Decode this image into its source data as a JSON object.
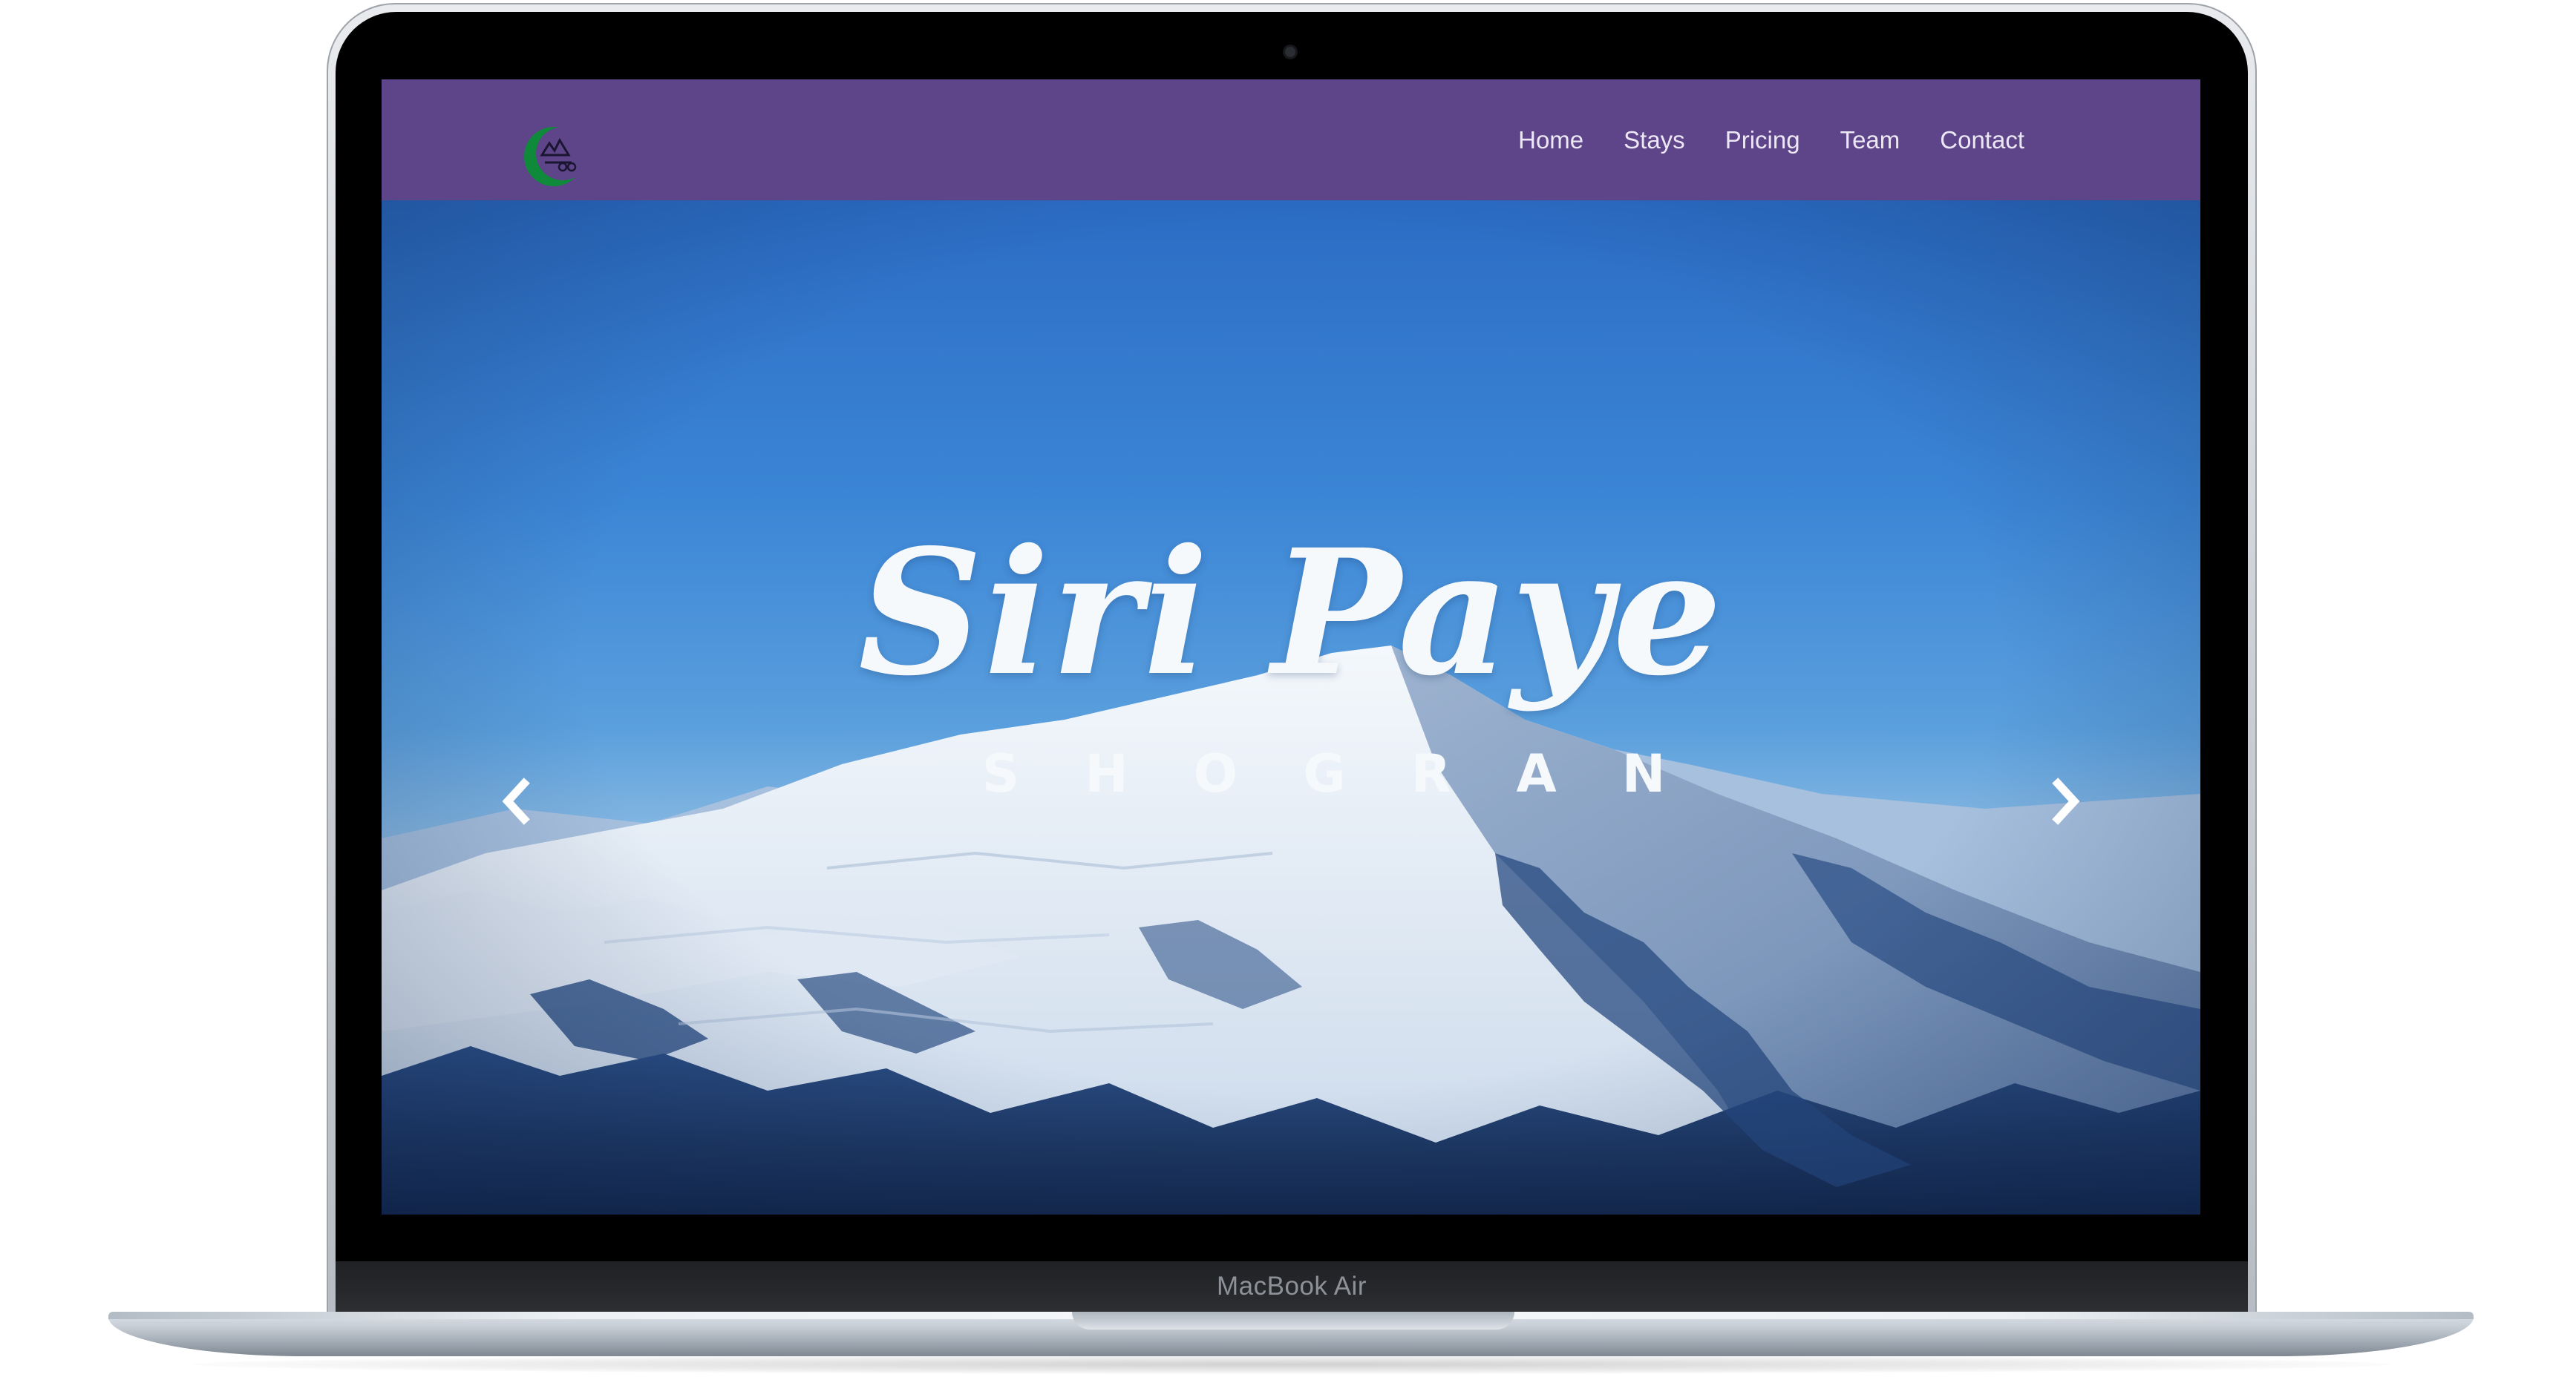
{
  "device": {
    "model_label": "MacBook Air"
  },
  "site": {
    "logo": {
      "name": "crescent-mountain-logo",
      "accent": "#0f8a3a"
    },
    "nav": {
      "items": [
        {
          "label": "Home"
        },
        {
          "label": "Stays"
        },
        {
          "label": "Pricing"
        },
        {
          "label": "Team"
        },
        {
          "label": "Contact"
        }
      ]
    },
    "hero": {
      "title": "Siri Paye",
      "subtitle": "SHOGRAN",
      "carousel": {
        "slide_count": 3,
        "active_index": 1,
        "prev_icon": "chevron-left-icon",
        "next_icon": "chevron-right-icon"
      }
    },
    "colors": {
      "navbar": "#5e4488",
      "nav_text": "#ece7f4",
      "sky_top": "#2b6cc4",
      "snow": "#eef3f8",
      "forest": "#1d3b6a"
    }
  }
}
